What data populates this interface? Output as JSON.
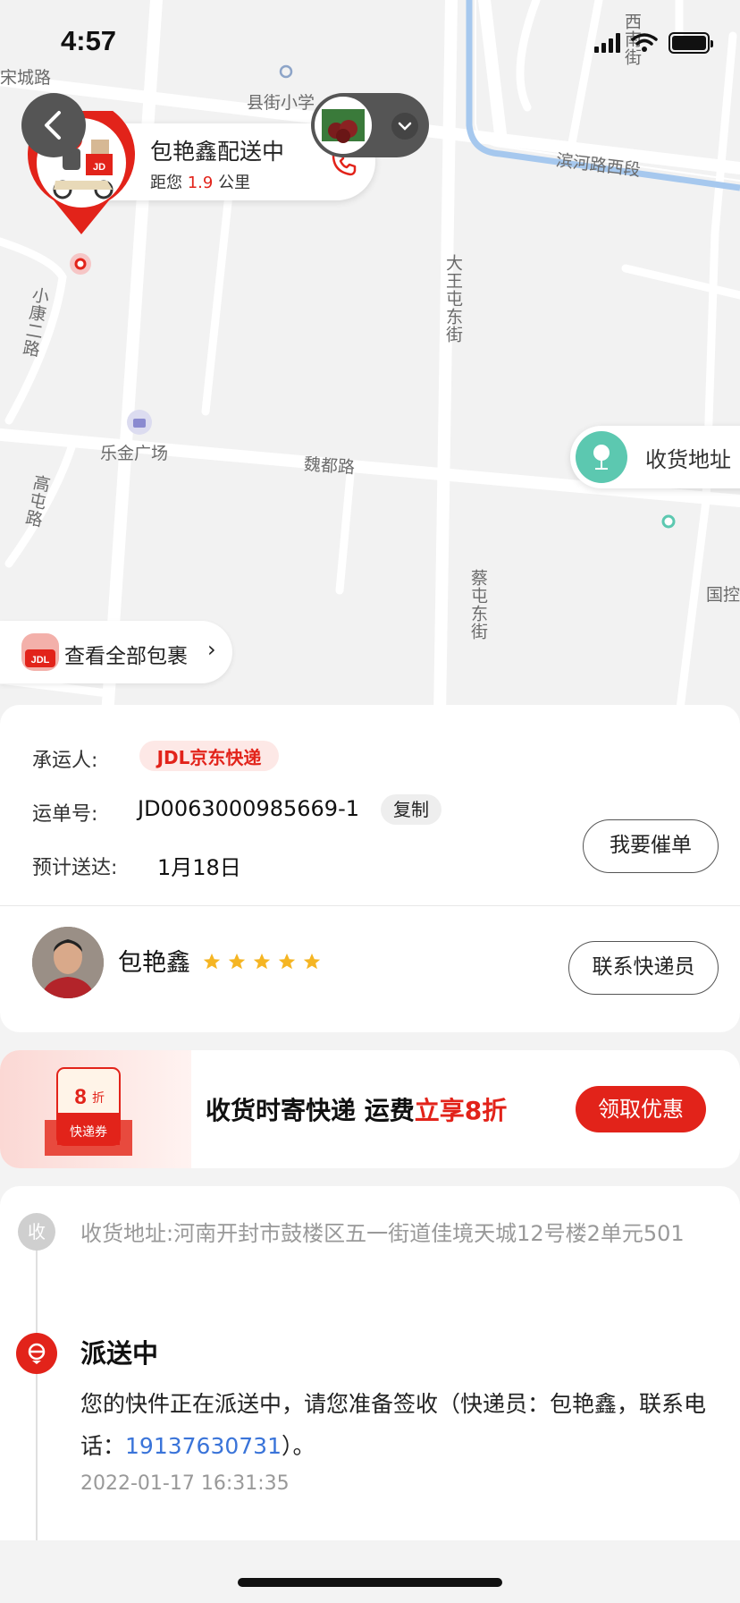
{
  "status_bar": {
    "time": "4:57"
  },
  "map": {
    "labels": {
      "songcheng": "宋城路",
      "xianjie": "县街小学",
      "binhe": "滨河路西段",
      "xinan": "西南街",
      "xiaokang": "小康二路",
      "dawangtun": "大王屯东街",
      "lejin": "乐金广场",
      "weidu": "魏都路",
      "gaotun": "高屯路",
      "caitun": "蔡屯东街",
      "guokong": "国控"
    },
    "courier_bubble": {
      "name": "包艳鑫配送中",
      "distance_prefix": "距您",
      "distance_value": "1.9",
      "distance_unit": "公里",
      "badge_text": "JD"
    },
    "address_pin_label": "收货地址",
    "all_packages_label": "查看全部包裹",
    "all_packages_arrow": "›",
    "all_packages_icon_text": "JDL"
  },
  "shipment": {
    "carrier_label": "承运人:",
    "carrier_name": "JDL京东快递",
    "waybill_label": "运单号:",
    "waybill_no": "JD0063000985669-1",
    "copy_label": "复制",
    "eta_label": "预计送达:",
    "eta_value": "1月18日",
    "urge_label": "我要催单"
  },
  "courier": {
    "name": "包艳鑫",
    "rating": 5,
    "contact_label": "联系快递员"
  },
  "promo": {
    "coupon_value": "8",
    "coupon_unit": "折",
    "coupon_label": "快递券",
    "text_prefix": "收货时寄快递 运费",
    "text_highlight": "立享8折",
    "button_label": "领取优惠"
  },
  "timeline": {
    "address_dot": "收",
    "address_text": "收货地址:河南开封市鼓楼区五一街道佳境天城12号楼2单元501",
    "status_title": "派送中",
    "desc_prefix": "您的快件正在派送中，请您准备签收（快递员：包艳鑫，联系电话：",
    "phone": "19137630731",
    "desc_suffix": "）。",
    "time": "2022-01-17 16:31:35"
  },
  "colors": {
    "brand_red": "#e2231a",
    "link_blue": "#3a74d9",
    "address_teal": "#5cc8b0"
  }
}
